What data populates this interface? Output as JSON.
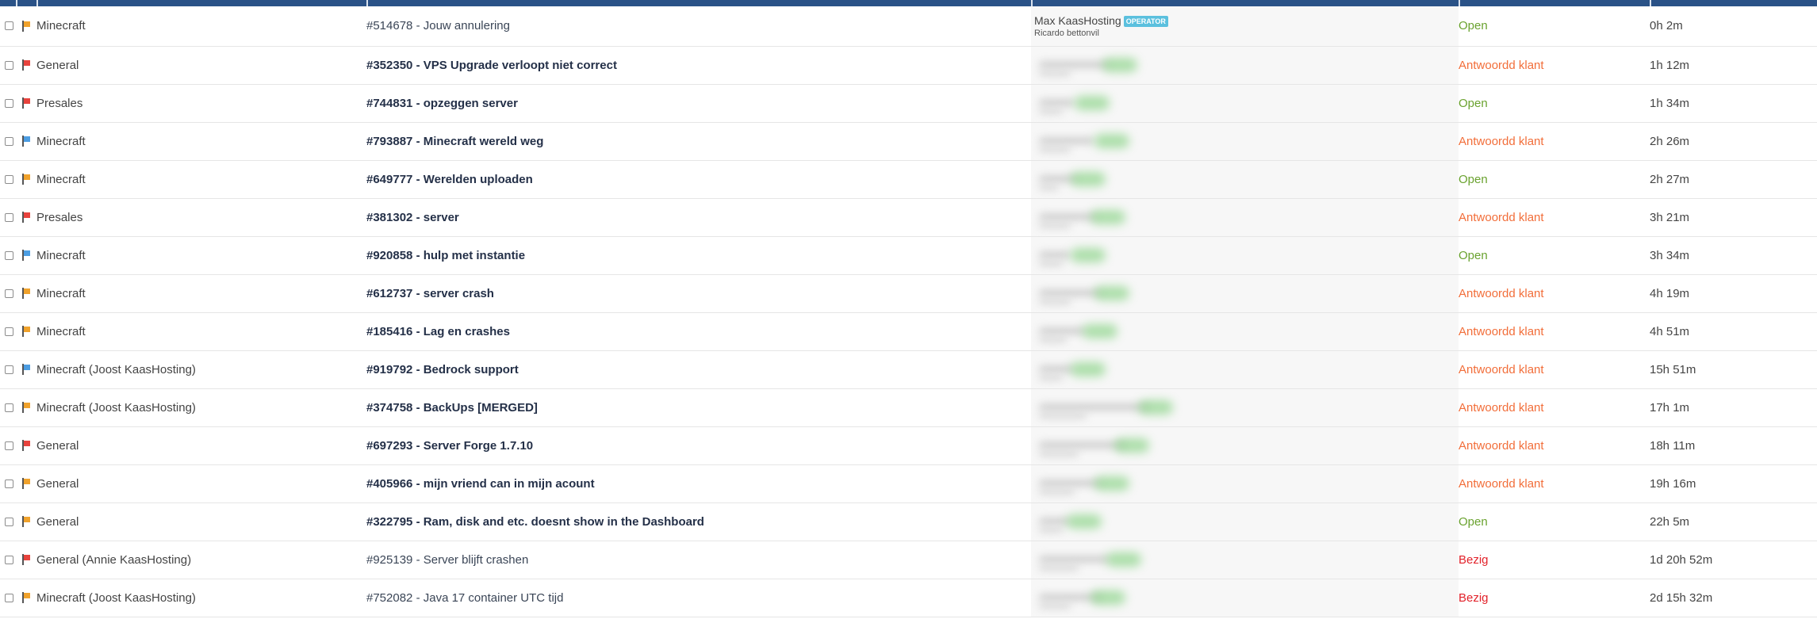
{
  "colors": {
    "header_bg": "#2a5287",
    "flag_orange": "#f0a22c",
    "flag_red": "#e8433d",
    "flag_blue": "#4c9de2",
    "status_open": "#6aa22f",
    "status_klant": "#f26e3a",
    "status_bezig": "#e2222a",
    "badge_bg": "#5bc0de"
  },
  "tickets": [
    {
      "flag": "orange",
      "department": "Minecraft",
      "subject": "#514678 - Jouw annulering",
      "bold": false,
      "user_name": "Max KaasHosting",
      "user_badge": "OPERATOR",
      "user_sub": "Ricardo bettonvil",
      "blurred": false,
      "status": "Open",
      "status_type": "open",
      "time": "0h 2m"
    },
    {
      "flag": "red",
      "department": "General",
      "subject": "#352350 - VPS Upgrade verloopt niet correct",
      "bold": true,
      "user_name": "",
      "user_badge": "",
      "user_sub": "",
      "blurred": true,
      "status": "Antwoordd klant",
      "status_type": "klant",
      "time": "1h 12m"
    },
    {
      "flag": "red",
      "department": "Presales",
      "subject": "#744831 - opzeggen server",
      "bold": true,
      "user_name": "",
      "user_badge": "",
      "user_sub": "",
      "blurred": true,
      "status": "Open",
      "status_type": "open",
      "time": "1h 34m"
    },
    {
      "flag": "blue",
      "department": "Minecraft",
      "subject": "#793887 - Minecraft wereld weg",
      "bold": true,
      "user_name": "",
      "user_badge": "",
      "user_sub": "",
      "blurred": true,
      "status": "Antwoordd klant",
      "status_type": "klant",
      "time": "2h 26m"
    },
    {
      "flag": "orange",
      "department": "Minecraft",
      "subject": "#649777 - Werelden uploaden",
      "bold": true,
      "user_name": "",
      "user_badge": "",
      "user_sub": "",
      "blurred": true,
      "status": "Open",
      "status_type": "open",
      "time": "2h 27m"
    },
    {
      "flag": "red",
      "department": "Presales",
      "subject": "#381302 - server",
      "bold": true,
      "user_name": "",
      "user_badge": "",
      "user_sub": "",
      "blurred": true,
      "status": "Antwoordd klant",
      "status_type": "klant",
      "time": "3h 21m"
    },
    {
      "flag": "blue",
      "department": "Minecraft",
      "subject": "#920858 - hulp met instantie",
      "bold": true,
      "user_name": "",
      "user_badge": "",
      "user_sub": "",
      "blurred": true,
      "status": "Open",
      "status_type": "open",
      "time": "3h 34m"
    },
    {
      "flag": "orange",
      "department": "Minecraft",
      "subject": "#612737 - server crash",
      "bold": true,
      "user_name": "",
      "user_badge": "",
      "user_sub": "",
      "blurred": true,
      "status": "Antwoordd klant",
      "status_type": "klant",
      "time": "4h 19m"
    },
    {
      "flag": "orange",
      "department": "Minecraft",
      "subject": "#185416 - Lag en crashes",
      "bold": true,
      "user_name": "",
      "user_badge": "",
      "user_sub": "",
      "blurred": true,
      "status": "Antwoordd klant",
      "status_type": "klant",
      "time": "4h 51m"
    },
    {
      "flag": "blue",
      "department": "Minecraft (Joost KaasHosting)",
      "subject": "#919792 - Bedrock support",
      "bold": true,
      "user_name": "",
      "user_badge": "",
      "user_sub": "",
      "blurred": true,
      "status": "Antwoordd klant",
      "status_type": "klant",
      "time": "15h 51m"
    },
    {
      "flag": "orange",
      "department": "Minecraft (Joost KaasHosting)",
      "subject": "#374758 - BackUps [MERGED]",
      "bold": true,
      "user_name": "",
      "user_badge": "",
      "user_sub": "",
      "blurred": true,
      "status": "Antwoordd klant",
      "status_type": "klant",
      "time": "17h 1m"
    },
    {
      "flag": "red",
      "department": "General",
      "subject": "#697293 - Server Forge 1.7.10",
      "bold": true,
      "user_name": "",
      "user_badge": "",
      "user_sub": "",
      "blurred": true,
      "status": "Antwoordd klant",
      "status_type": "klant",
      "time": "18h 11m"
    },
    {
      "flag": "orange",
      "department": "General",
      "subject": "#405966 - mijn vriend can in mijn acount",
      "bold": true,
      "user_name": "",
      "user_badge": "",
      "user_sub": "",
      "blurred": true,
      "status": "Antwoordd klant",
      "status_type": "klant",
      "time": "19h 16m"
    },
    {
      "flag": "orange",
      "department": "General",
      "subject": "#322795 - Ram, disk and etc. doesnt show in the Dashboard",
      "bold": true,
      "user_name": "",
      "user_badge": "",
      "user_sub": "",
      "blurred": true,
      "status": "Open",
      "status_type": "open",
      "time": "22h 5m"
    },
    {
      "flag": "red",
      "department": "General (Annie KaasHosting)",
      "subject": "#925139 - Server blijft crashen",
      "bold": false,
      "user_name": "",
      "user_badge": "",
      "user_sub": "",
      "blurred": true,
      "status": "Bezig",
      "status_type": "bezig",
      "time": "1d 20h 52m"
    },
    {
      "flag": "orange",
      "department": "Minecraft (Joost KaasHosting)",
      "subject": "#752082 - Java 17 container UTC tijd",
      "bold": false,
      "user_name": "",
      "user_badge": "",
      "user_sub": "",
      "blurred": true,
      "status": "Bezig",
      "status_type": "bezig",
      "time": "2d 15h 32m"
    }
  ]
}
